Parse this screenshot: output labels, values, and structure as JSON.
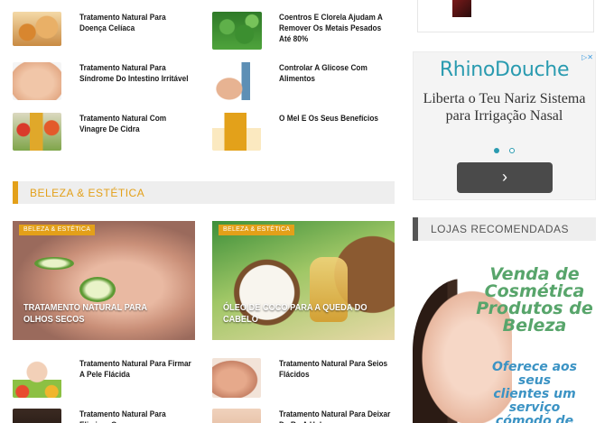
{
  "posts_top": [
    {
      "title": "Tratamento Natural Para Doença Celíaca",
      "icon": "bread-photo"
    },
    {
      "title": "Coentros E Clorela Ajudam A Remover Os Metais Pesados Até 80%",
      "icon": "herb-photo"
    },
    {
      "title": "Tratamento Natural Para Síndrome Do Intestino Irritável",
      "icon": "belly-photo"
    },
    {
      "title": "Controlar A Glicose Com Alimentos",
      "icon": "glucose-test-photo"
    },
    {
      "title": "Tratamento Natural Com Vinagre De Cidra",
      "icon": "vinegar-photo"
    },
    {
      "title": "O Mel E Os Seus Benefícios",
      "icon": "honey-photo"
    }
  ],
  "section": {
    "title": "BELEZA & ESTÉTICA",
    "accent": "#e3a019"
  },
  "featured": [
    {
      "category": "BELEZA & ESTÉTICA",
      "title": "TRATAMENTO NATURAL PARA OLHOS SECOS"
    },
    {
      "category": "BELEZA & ESTÉTICA",
      "title": "ÓLEO DE COCO PARA A QUEDA DO CABELO"
    }
  ],
  "posts_bottom": [
    {
      "title": "Tratamento Natural Para Firmar A Pele Flácida",
      "icon": "fruit-face-photo"
    },
    {
      "title": "Tratamento Natural Para Seios Flácidos",
      "icon": "body-photo"
    },
    {
      "title": "Tratamento Natural Para Eliminar O...",
      "icon": "hair-photo"
    },
    {
      "title": "Tratamento Natural Para Deixar De Ro A Unha...",
      "icon": "skin-photo"
    }
  ],
  "ad": {
    "brand": "RhinoDouche",
    "tagline": "Liberta o Teu Nariz Sistema para Irrigação Nasal",
    "arrow": "›",
    "brand_color": "#2a9bb0"
  },
  "widget": {
    "title": "LOJAS RECOMENDADAS"
  },
  "banner": {
    "headline": "Venda de Cosmética Produtos de Beleza",
    "sub": "Oferece aos seus clientes um serviço cómodo de"
  }
}
